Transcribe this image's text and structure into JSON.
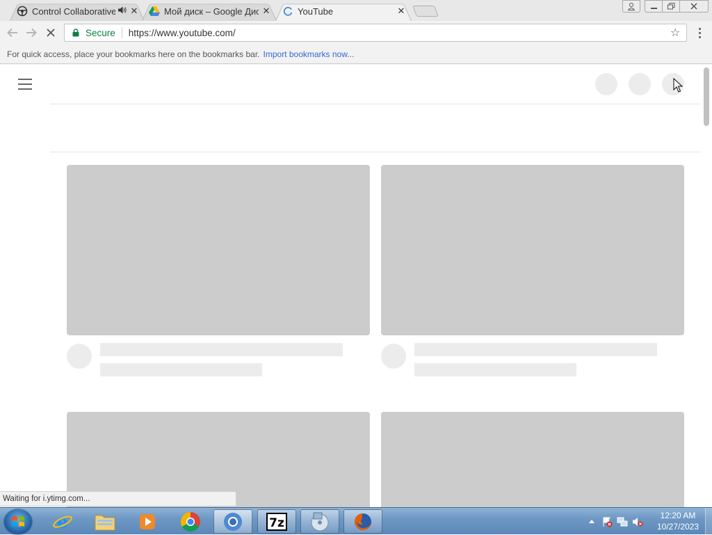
{
  "browser": {
    "tabs": [
      {
        "title": "Control Collaborative",
        "icon": "steering-wheel-icon",
        "has_audio": true,
        "active": false
      },
      {
        "title": "Мой диск – Google Диск",
        "icon": "google-drive-icon",
        "has_audio": false,
        "active": false
      },
      {
        "title": "YouTube",
        "icon": "loading-spinner-icon",
        "has_audio": false,
        "active": true
      }
    ],
    "tab_close_glyph": "✕",
    "omnibox": {
      "secure_label": "Secure",
      "url": "https://www.youtube.com/"
    },
    "bookmarks_bar": {
      "message": "For quick access, place your bookmarks here on the bookmarks bar.",
      "import_link": "Import bookmarks now..."
    },
    "status_text": "Waiting for i.ytimg.com...",
    "colors": {
      "secure_green": "#0b8043",
      "link_blue": "#3367d6",
      "placeholder_gray": "#cccccc"
    }
  },
  "taskbar": {
    "apps": [
      {
        "name": "internet-explorer",
        "open": false
      },
      {
        "name": "windows-explorer",
        "open": false
      },
      {
        "name": "windows-media-player",
        "open": false
      },
      {
        "name": "google-chrome",
        "open": false
      },
      {
        "name": "chromium",
        "open": true
      },
      {
        "name": "7-zip",
        "open": true
      },
      {
        "name": "disk-tool",
        "open": true
      },
      {
        "name": "firefox",
        "open": true
      }
    ],
    "clock": {
      "time": "12:20 AM",
      "date": "10/27/2023"
    }
  }
}
